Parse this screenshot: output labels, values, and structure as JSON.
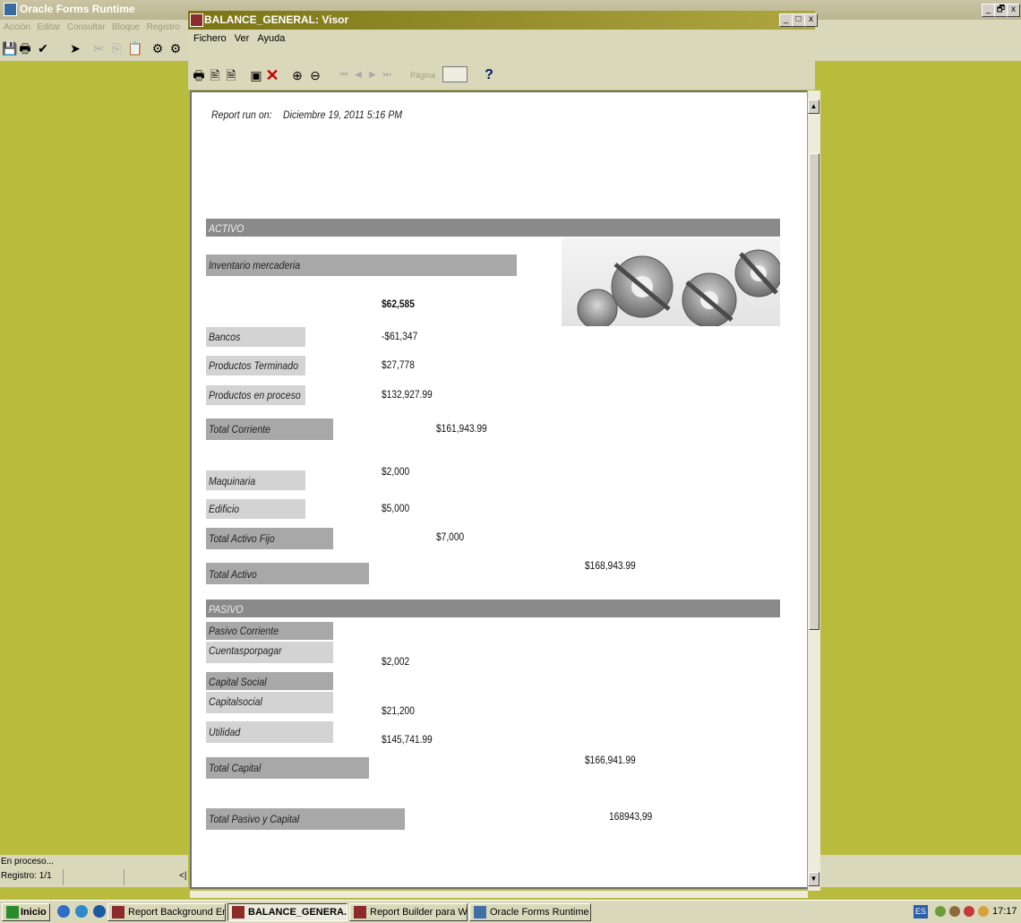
{
  "outer_window": {
    "title": "Oracle Forms Runtime",
    "menu": [
      "Acción",
      "Editar",
      "Consultar",
      "Bloque",
      "Registro"
    ],
    "controls": [
      "_",
      "🗗",
      "x"
    ]
  },
  "viewer_window": {
    "title": "BALANCE_GENERAL: Visor",
    "menu": [
      "Fichero",
      "Ver",
      "Ayuda"
    ],
    "controls": [
      "_",
      "□",
      "x"
    ],
    "page_label": "Página",
    "page_value": "",
    "help_glyph": "?"
  },
  "report": {
    "run_label": "Report run on:",
    "run_date": "Diciembre 19, 2011 5:16 PM",
    "sections": {
      "activo": "ACTIVO",
      "pasivo": "PASIVO"
    },
    "rows": {
      "inventario_label": "Inventario mercaderia",
      "inventario_value": "$62,585",
      "bancos_label": "Bancos",
      "bancos_value": "-$61,347",
      "prod_term_label": "Productos Terminado",
      "prod_term_value": "$27,778",
      "prod_proc_label": "Productos en proceso",
      "prod_proc_value": "$132,927.99",
      "total_corriente_label": "Total Corriente",
      "total_corriente_value": "$161,943.99",
      "maquinaria_label": "Maquinaria",
      "maquinaria_value": "$2,000",
      "edificio_label": "Edificio",
      "edificio_value": "$5,000",
      "total_activo_fijo_label": "Total Activo Fijo",
      "total_activo_fijo_value": "$7,000",
      "total_activo_label": "Total Activo",
      "total_activo_value": "$168,943.99",
      "pasivo_corriente_label": "Pasivo Corriente",
      "cuentas_label": "Cuentasporpagar",
      "cuentas_value": "$2,002",
      "capital_social_label": "Capital Social",
      "capitalsocial_label": "Capitalsocial",
      "capitalsocial_value": "$21,200",
      "utilidad_label": "Utilidad",
      "utilidad_value": "$145,741.99",
      "total_capital_label": "Total Capital",
      "total_capital_value": "$166,941.99",
      "total_pasivo_capital_label": "Total Pasivo y Capital",
      "total_pasivo_capital_value": "168943,99"
    }
  },
  "status": {
    "line1": "En proceso...",
    "line2": "Registro: 1/1",
    "extra": "<|"
  },
  "taskbar": {
    "start": "Inicio",
    "tasks": [
      "Report Background Engine",
      "BALANCE_GENERA...",
      "Report Builder para Wind...",
      "Oracle Forms Runtime"
    ],
    "lang": "ES",
    "clock": "17:17"
  }
}
